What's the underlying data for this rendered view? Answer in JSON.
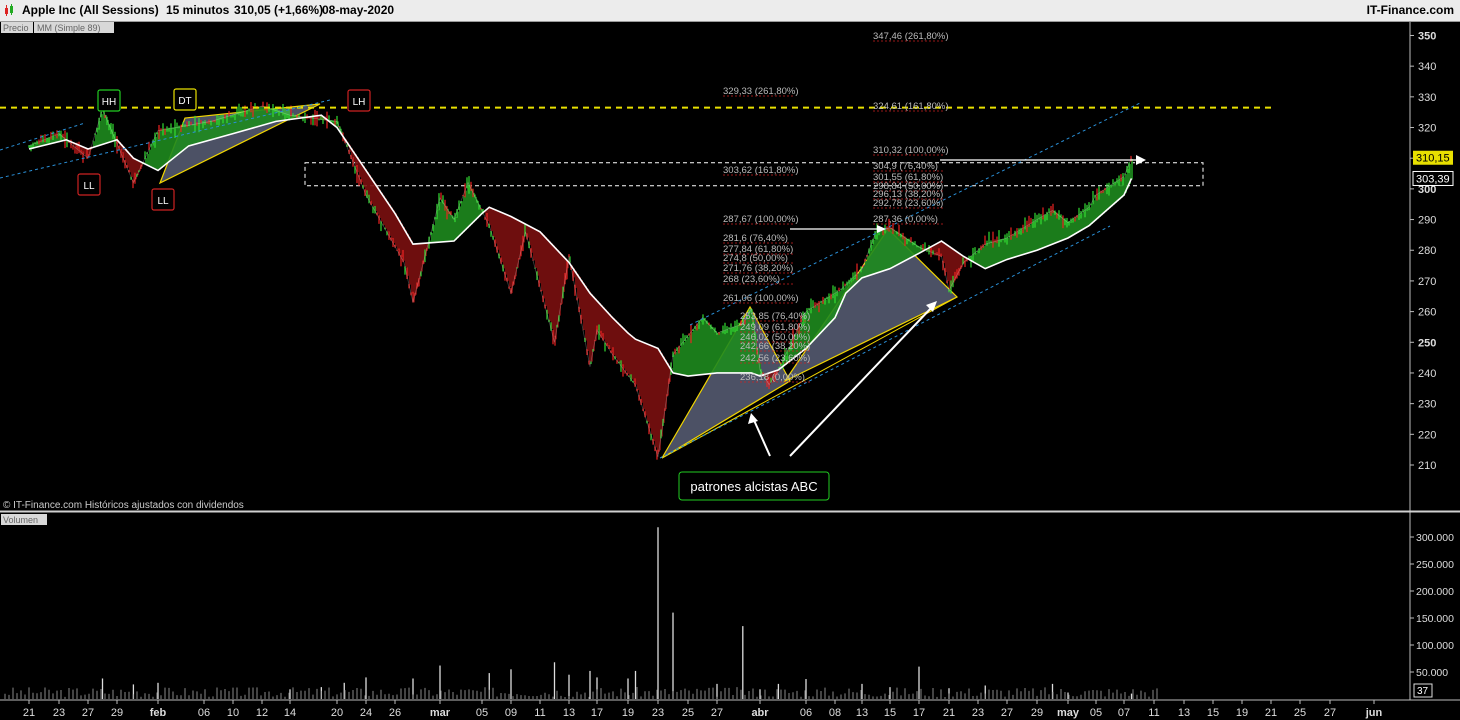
{
  "header": {
    "instrument": "Apple Inc (All Sessions)",
    "timeframe": "15 minutos",
    "quote": "310,05 (+1,66%)",
    "date": "08-may-2020",
    "brand": "IT-Finance.com"
  },
  "legend": {
    "price_tag": "Precio",
    "ma_tag": "MM (Simple 89)",
    "volume_tag": "Volumen",
    "copyright": "© IT-Finance.com  Históricos ajustados con dividendos"
  },
  "annotations": {
    "callout": "patrones alcistas ABC",
    "pivots": [
      {
        "label": "HH",
        "color": "#22cc22"
      },
      {
        "label": "DT",
        "color": "#e8e000"
      },
      {
        "label": "LH",
        "color": "#cc2222"
      },
      {
        "label": "LL",
        "color": "#cc2222"
      },
      {
        "label": "LL",
        "color": "#cc2222"
      }
    ],
    "fib_labels": [
      "347,46 (261,80%)",
      "324,61 (161,80%)",
      "310,32 (100,00%)",
      "304,9 (76,40%)",
      "301,55 (61,80%)",
      "298,84 (50,00%)",
      "296,13 (38,20%)",
      "292,78 (23,60%)",
      "287,36 (0,00%)",
      "287,67 (100,00%)",
      "281,6 (76,40%)",
      "277,84 (61,80%)",
      "274,8 (50,00%)",
      "271,76 (38,20%)",
      "268 (23,60%)",
      "261,06 (100,00%)",
      "253,85 (76,40%)",
      "249,09 (61,80%)",
      "246,02 (50,00%)",
      "242,66 (38,20%)",
      "242,56 (23,60%)",
      "236,18 (0,00%)",
      "329,33 (261,80%)",
      "303,62 (161,80%)"
    ]
  },
  "colors": {
    "background": "#000000",
    "ma_line": "#ffffff",
    "fill_above": "#1e8a1e",
    "fill_below": "#7a1010",
    "resistance": "#e8e000",
    "channel": "#2a8fd6",
    "abc_fill": "#8a94b8"
  },
  "chart_data": [
    {
      "type": "line",
      "title": "Apple Inc (All Sessions) 15 minutos",
      "series": [
        {
          "name": "MM (Simple 89)",
          "points": [
            [
              "2020-01-21",
              313
            ],
            [
              "2020-01-24",
              316
            ],
            [
              "2020-01-27",
              313
            ],
            [
              "2020-01-29",
              316
            ],
            [
              "2020-01-31",
              310
            ],
            [
              "2020-02-03",
              306
            ],
            [
              "2020-02-05",
              314
            ],
            [
              "2020-02-10",
              318
            ],
            [
              "2020-02-13",
              322
            ],
            [
              "2020-02-18",
              324
            ],
            [
              "2020-02-20",
              320
            ],
            [
              "2020-02-24",
              306
            ],
            [
              "2020-02-26",
              292
            ],
            [
              "2020-02-28",
              282
            ],
            [
              "2020-03-03",
              283
            ],
            [
              "2020-03-05",
              292
            ],
            [
              "2020-03-06",
              294
            ],
            [
              "2020-03-09",
              291
            ],
            [
              "2020-03-11",
              286
            ],
            [
              "2020-03-13",
              276
            ],
            [
              "2020-03-16",
              266
            ],
            [
              "2020-03-18",
              258
            ],
            [
              "2020-03-19",
              253
            ],
            [
              "2020-03-20",
              251
            ],
            [
              "2020-03-23",
              248
            ],
            [
              "2020-03-24",
              240
            ],
            [
              "2020-03-25",
              239
            ],
            [
              "2020-03-27",
              240
            ],
            [
              "2020-03-31",
              240
            ],
            [
              "2020-04-01",
              239
            ],
            [
              "2020-04-03",
              241
            ],
            [
              "2020-04-06",
              248
            ],
            [
              "2020-04-08",
              258
            ],
            [
              "2020-04-10",
              266
            ],
            [
              "2020-04-13",
              271
            ],
            [
              "2020-04-15",
              274
            ],
            [
              "2020-04-17",
              279
            ],
            [
              "2020-04-20",
              283
            ],
            [
              "2020-04-22",
              278
            ],
            [
              "2020-04-24",
              274
            ],
            [
              "2020-04-27",
              277
            ],
            [
              "2020-04-29",
              280
            ],
            [
              "2020-05-01",
              284
            ],
            [
              "2020-05-04",
              288
            ],
            [
              "2020-05-06",
              294
            ],
            [
              "2020-05-07",
              298
            ],
            [
              "2020-05-08",
              303.39
            ]
          ]
        },
        {
          "name": "Precio",
          "points": [
            [
              "2020-01-21",
              314
            ],
            [
              "2020-01-23",
              318
            ],
            [
              "2020-01-27",
              310
            ],
            [
              "2020-01-28",
              326
            ],
            [
              "2020-01-31",
              302
            ],
            [
              "2020-02-03",
              319
            ],
            [
              "2020-02-07",
              322
            ],
            [
              "2020-02-12",
              327
            ],
            [
              "2020-02-14",
              324
            ],
            [
              "2020-02-20",
              322
            ],
            [
              "2020-02-24",
              298
            ],
            [
              "2020-02-27",
              276
            ],
            [
              "2020-02-28",
              263
            ],
            [
              "2020-03-02",
              297
            ],
            [
              "2020-03-03",
              290
            ],
            [
              "2020-03-04",
              302
            ],
            [
              "2020-03-06",
              288
            ],
            [
              "2020-03-09",
              266
            ],
            [
              "2020-03-10",
              286
            ],
            [
              "2020-03-12",
              250
            ],
            [
              "2020-03-13",
              278
            ],
            [
              "2020-03-16",
              242
            ],
            [
              "2020-03-17",
              254
            ],
            [
              "2020-03-18",
              246
            ],
            [
              "2020-03-20",
              236
            ],
            [
              "2020-03-23",
              212.6
            ],
            [
              "2020-03-24",
              246
            ],
            [
              "2020-03-26",
              258
            ],
            [
              "2020-03-27",
              253
            ],
            [
              "2020-03-30",
              256
            ],
            [
              "2020-03-31",
              261
            ],
            [
              "2020-04-01",
              241
            ],
            [
              "2020-04-02",
              236.2
            ],
            [
              "2020-04-03",
              241
            ],
            [
              "2020-04-06",
              260
            ],
            [
              "2020-04-08",
              266
            ],
            [
              "2020-04-09",
              267
            ],
            [
              "2020-04-13",
              274
            ],
            [
              "2020-04-14",
              286
            ],
            [
              "2020-04-15",
              287.4
            ],
            [
              "2020-04-17",
              281
            ],
            [
              "2020-04-20",
              278
            ],
            [
              "2020-04-21",
              267
            ],
            [
              "2020-04-22",
              276
            ],
            [
              "2020-04-24",
              282
            ],
            [
              "2020-04-27",
              284
            ],
            [
              "2020-04-29",
              290
            ],
            [
              "2020-04-30",
              293
            ],
            [
              "2020-05-01",
              289
            ],
            [
              "2020-05-04",
              294
            ],
            [
              "2020-05-05",
              298
            ],
            [
              "2020-05-06",
              301
            ],
            [
              "2020-05-07",
              304
            ],
            [
              "2020-05-08",
              310.15
            ]
          ]
        }
      ],
      "last_price": 310.15,
      "ma_value": 303.39,
      "resistance_level": 326.5,
      "zone": [
        301,
        308.5
      ],
      "ylim": [
        200,
        355
      ],
      "yticks": [
        210,
        220,
        230,
        240,
        250,
        260,
        270,
        280,
        290,
        300,
        310,
        320,
        330,
        340,
        350
      ],
      "ytick_labels": [
        "210",
        "220",
        "230",
        "240",
        "250",
        "260",
        "270",
        "280",
        "290",
        "300",
        "310",
        "320",
        "330",
        "340",
        "350"
      ],
      "xticks": [
        {
          "label": "21",
          "date": "2020-01-21"
        },
        {
          "label": "23",
          "date": "2020-01-23"
        },
        {
          "label": "27",
          "date": "2020-01-27"
        },
        {
          "label": "29",
          "date": "2020-01-29"
        },
        {
          "label": "feb",
          "date": "2020-02-03"
        },
        {
          "label": "06",
          "date": "2020-02-06"
        },
        {
          "label": "10",
          "date": "2020-02-10"
        },
        {
          "label": "12",
          "date": "2020-02-12"
        },
        {
          "label": "14",
          "date": "2020-02-14"
        },
        {
          "label": "20",
          "date": "2020-02-20"
        },
        {
          "label": "24",
          "date": "2020-02-24"
        },
        {
          "label": "26",
          "date": "2020-02-26"
        },
        {
          "label": "mar",
          "date": "2020-03-02"
        },
        {
          "label": "05",
          "date": "2020-03-05"
        },
        {
          "label": "09",
          "date": "2020-03-09"
        },
        {
          "label": "11",
          "date": "2020-03-11"
        },
        {
          "label": "13",
          "date": "2020-03-13"
        },
        {
          "label": "17",
          "date": "2020-03-17"
        },
        {
          "label": "19",
          "date": "2020-03-19"
        },
        {
          "label": "23",
          "date": "2020-03-23"
        },
        {
          "label": "25",
          "date": "2020-03-25"
        },
        {
          "label": "27",
          "date": "2020-03-27"
        },
        {
          "label": "abr",
          "date": "2020-04-01"
        },
        {
          "label": "06",
          "date": "2020-04-06"
        },
        {
          "label": "08",
          "date": "2020-04-08"
        },
        {
          "label": "13",
          "date": "2020-04-13"
        },
        {
          "label": "15",
          "date": "2020-04-15"
        },
        {
          "label": "17",
          "date": "2020-04-17"
        },
        {
          "label": "21",
          "date": "2020-04-21"
        },
        {
          "label": "23",
          "date": "2020-04-23"
        },
        {
          "label": "27",
          "date": "2020-04-27"
        },
        {
          "label": "29",
          "date": "2020-04-29"
        },
        {
          "label": "may",
          "date": "2020-05-01"
        },
        {
          "label": "05",
          "date": "2020-05-05"
        },
        {
          "label": "07",
          "date": "2020-05-07"
        },
        {
          "label": "11",
          "date": "2020-05-11"
        },
        {
          "label": "13",
          "date": "2020-05-13"
        },
        {
          "label": "15",
          "date": "2020-05-15"
        },
        {
          "label": "19",
          "date": "2020-05-19"
        },
        {
          "label": "21",
          "date": "2020-05-21"
        },
        {
          "label": "25",
          "date": "2020-05-25"
        },
        {
          "label": "27",
          "date": "2020-05-27"
        },
        {
          "label": "jun",
          "date": "2020-06-01"
        }
      ]
    },
    {
      "type": "bar",
      "title": "Volumen",
      "series": [
        {
          "name": "Volumen",
          "points": [
            [
              "2020-01-28",
              38000
            ],
            [
              "2020-01-31",
              27000
            ],
            [
              "2020-02-03",
              30000
            ],
            [
              "2020-02-14",
              18000
            ],
            [
              "2020-02-18",
              22000
            ],
            [
              "2020-02-21",
              30000
            ],
            [
              "2020-02-24",
              40000
            ],
            [
              "2020-02-28",
              38000
            ],
            [
              "2020-03-02",
              62000
            ],
            [
              "2020-03-06",
              48000
            ],
            [
              "2020-03-09",
              55000
            ],
            [
              "2020-03-12",
              68000
            ],
            [
              "2020-03-13",
              45000
            ],
            [
              "2020-03-16",
              52000
            ],
            [
              "2020-03-17",
              40000
            ],
            [
              "2020-03-19",
              38000
            ],
            [
              "2020-03-20",
              52000
            ],
            [
              "2020-03-23",
              318000
            ],
            [
              "2020-03-24",
              160000
            ],
            [
              "2020-03-27",
              28000
            ],
            [
              "2020-03-30",
              135000
            ],
            [
              "2020-04-01",
              18000
            ],
            [
              "2020-04-03",
              28000
            ],
            [
              "2020-04-06",
              37000
            ],
            [
              "2020-04-13",
              28000
            ],
            [
              "2020-04-15",
              22000
            ],
            [
              "2020-04-17",
              60000
            ],
            [
              "2020-04-21",
              20000
            ],
            [
              "2020-04-24",
              25000
            ],
            [
              "2020-04-30",
              28000
            ],
            [
              "2020-05-01",
              12000
            ],
            [
              "2020-05-08",
              10000
            ]
          ]
        }
      ],
      "last_value": 37,
      "ylim": [
        0,
        330000
      ],
      "yticks": [
        50000,
        100000,
        150000,
        200000,
        250000,
        300000
      ],
      "ytick_labels": [
        "50.000",
        "100.000",
        "150.000",
        "200.000",
        "250.000",
        "300.000"
      ]
    }
  ]
}
